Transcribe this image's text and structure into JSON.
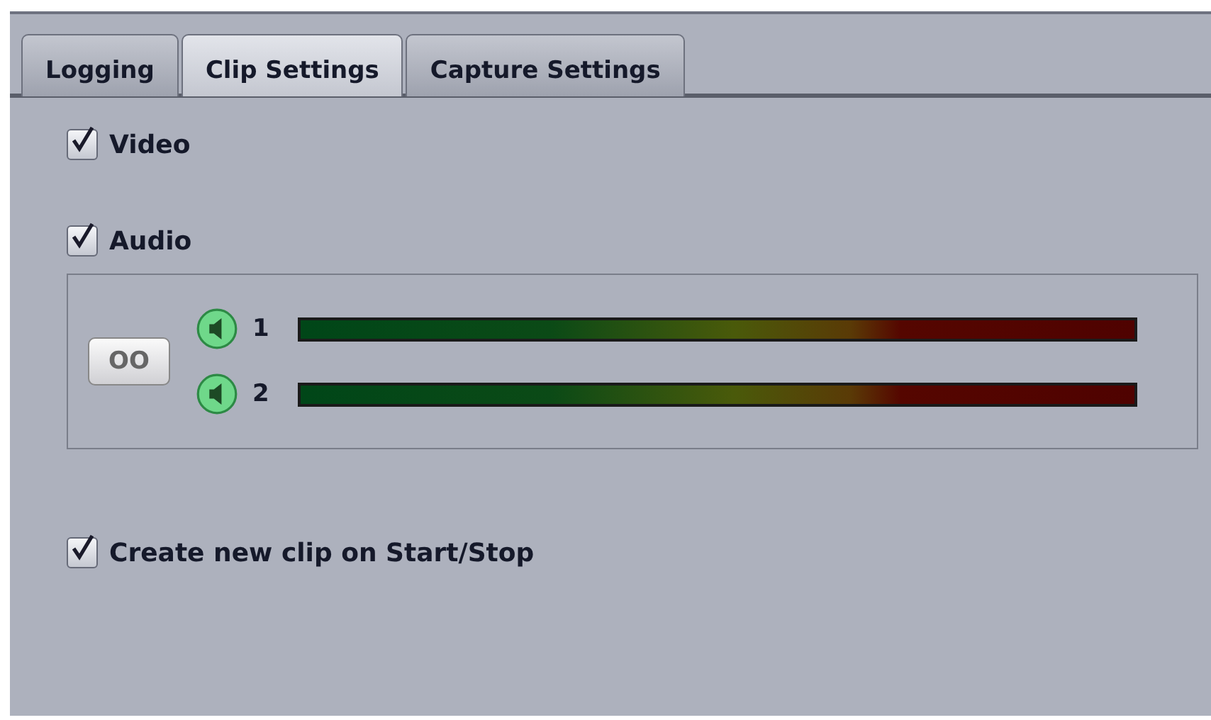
{
  "tabs": [
    {
      "label": "Logging",
      "selected": false
    },
    {
      "label": "Clip Settings",
      "selected": true
    },
    {
      "label": "Capture Settings",
      "selected": false
    }
  ],
  "options": [
    {
      "label": "Video",
      "checked": true
    },
    {
      "label": "Audio",
      "checked": true
    }
  ],
  "audio_channels": [
    {
      "label": "1",
      "enabled": true
    },
    {
      "label": "2",
      "enabled": true
    }
  ],
  "link_button": {
    "label": "OO"
  },
  "create_clip": {
    "label": "Create new clip on Start/Stop",
    "checked": true
  }
}
